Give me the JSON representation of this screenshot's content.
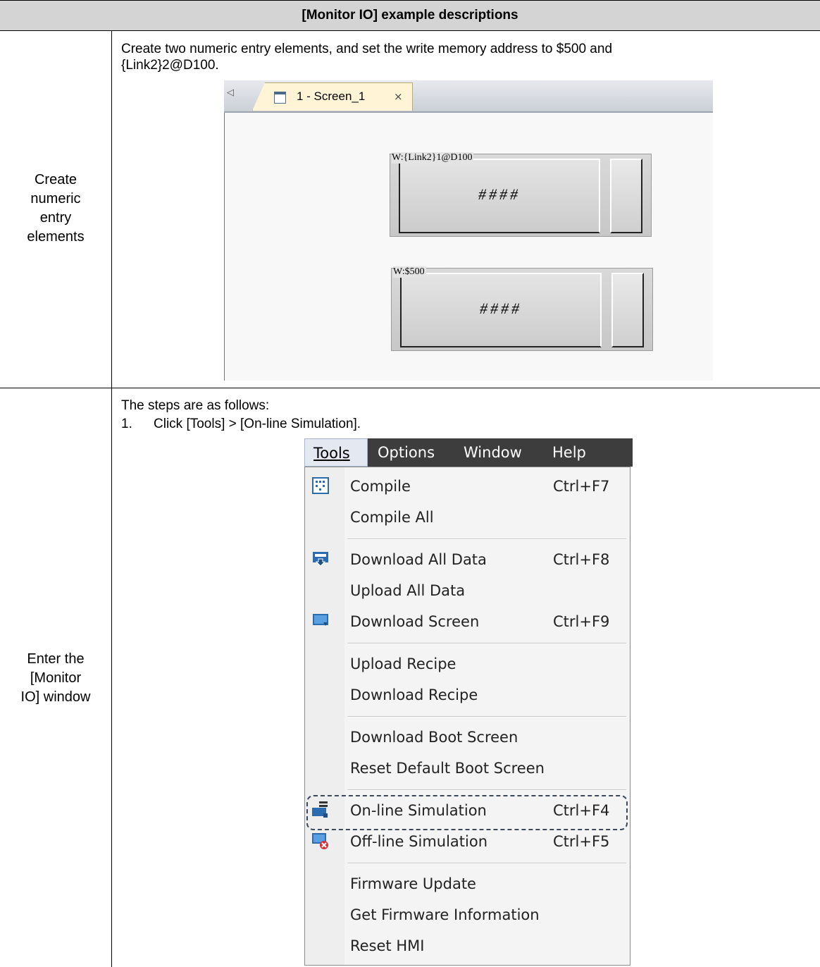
{
  "table": {
    "header": "[Monitor IO] example descriptions",
    "row1": {
      "label_lines": [
        "Create",
        "numeric",
        "entry",
        "elements"
      ],
      "description_lines": [
        "Create two numeric entry elements, and set the write memory address to $500 and",
        "{Link2}2@D100."
      ]
    },
    "row2": {
      "label_lines": [
        "Enter the",
        "[Monitor",
        "IO] window"
      ],
      "intro": "The steps are as follows:",
      "step_number": "1.",
      "step_text": "Click [Tools] > [On-line Simulation]."
    }
  },
  "editor": {
    "tab_label": "1 - Screen_1",
    "tab_close": "×",
    "scroll_arrow": "◁",
    "elements": [
      {
        "address": "W:{Link2}1@D100",
        "display": "####"
      },
      {
        "address": "W:$500",
        "display": "####"
      }
    ]
  },
  "menu": {
    "menubar": [
      "Tools",
      "Options",
      "Window",
      "Help"
    ],
    "active": "Tools",
    "items": [
      {
        "label": "Compile",
        "shortcut": "Ctrl+F7",
        "icon": "compile-icon"
      },
      {
        "label": "Compile All",
        "shortcut": ""
      },
      {
        "label": "Download All Data",
        "shortcut": "Ctrl+F8",
        "icon": "download-all-icon"
      },
      {
        "label": "Upload All Data",
        "shortcut": ""
      },
      {
        "label": "Download Screen",
        "shortcut": "Ctrl+F9",
        "icon": "download-screen-icon"
      },
      {
        "label": "Upload Recipe",
        "shortcut": ""
      },
      {
        "label": "Download Recipe",
        "shortcut": ""
      },
      {
        "label": "Download Boot Screen",
        "shortcut": ""
      },
      {
        "label": "Reset Default Boot Screen",
        "shortcut": ""
      },
      {
        "label": "On-line Simulation",
        "shortcut": "Ctrl+F4",
        "icon": "online-simulation-icon",
        "highlighted": true
      },
      {
        "label": "Off-line Simulation",
        "shortcut": "Ctrl+F5",
        "icon": "offline-simulation-icon"
      },
      {
        "label": "Firmware Update",
        "shortcut": ""
      },
      {
        "label": "Get Firmware Information",
        "shortcut": ""
      },
      {
        "label": "Reset HMI",
        "shortcut": ""
      }
    ],
    "colors": {
      "menubar": "#3d3d3d",
      "dropdown": "#f4f4f4",
      "highlight_border": "#3a4a5c",
      "icon_blue": "#2b6cb0",
      "icon_red": "#d9303a"
    }
  }
}
